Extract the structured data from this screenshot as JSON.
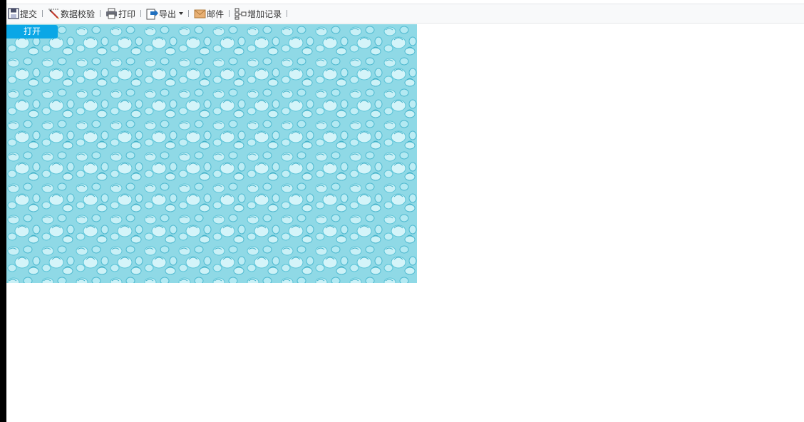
{
  "toolbar": {
    "items": [
      {
        "label": "提交",
        "icon": "save-icon"
      },
      {
        "label": "数据校验",
        "icon": "pencil-check-icon"
      },
      {
        "label": "打印",
        "icon": "printer-icon"
      },
      {
        "label": "导出",
        "icon": "export-icon",
        "has_dropdown": true
      },
      {
        "label": "邮件",
        "icon": "envelope-icon"
      },
      {
        "label": "增加记录",
        "icon": "add-record-icon"
      }
    ]
  },
  "content": {
    "open_button_label": "打开",
    "background_color": "#8fd9e6"
  },
  "colors": {
    "accent": "#0aa7e6",
    "toolbar_bg": "#f8f9fa"
  }
}
